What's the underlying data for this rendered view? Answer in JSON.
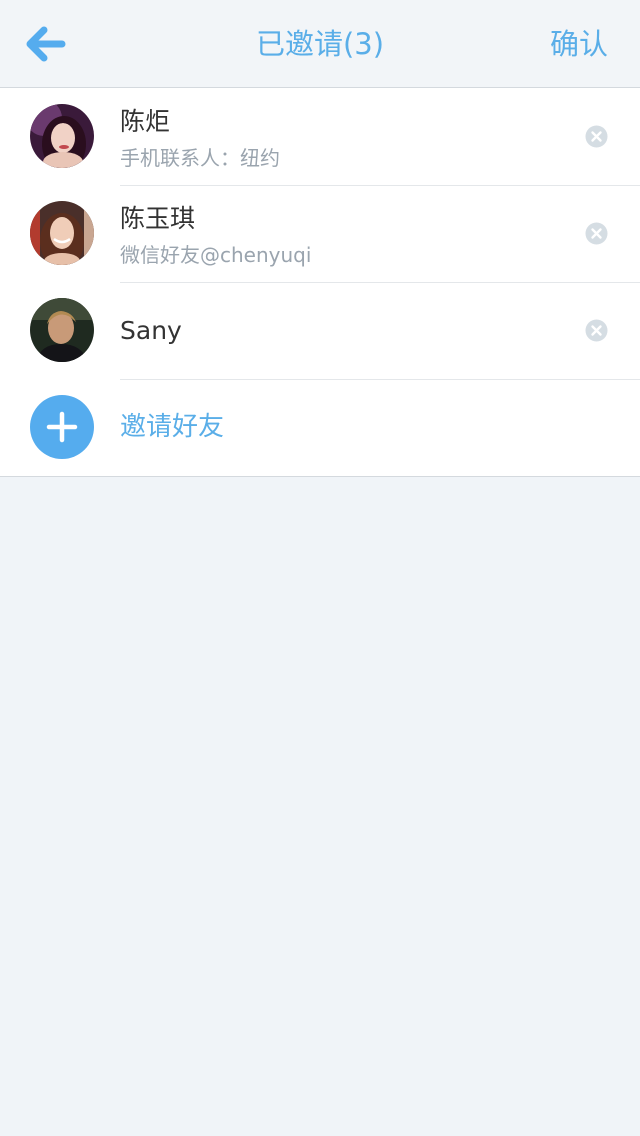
{
  "nav": {
    "title": "已邀请(3)",
    "confirm_label": "确认",
    "accent_color": "#5aaee8"
  },
  "invitees": [
    {
      "name": "陈炬",
      "subtitle": "手机联系人：纽约"
    },
    {
      "name": "陈玉琪",
      "subtitle": "微信好友@chenyuqi"
    },
    {
      "name": "Sany",
      "subtitle": ""
    }
  ],
  "invite_action": {
    "label": "邀请好友",
    "icon": "plus-icon"
  },
  "icons": {
    "back": "arrow-left-icon",
    "remove": "remove-circle-icon"
  }
}
